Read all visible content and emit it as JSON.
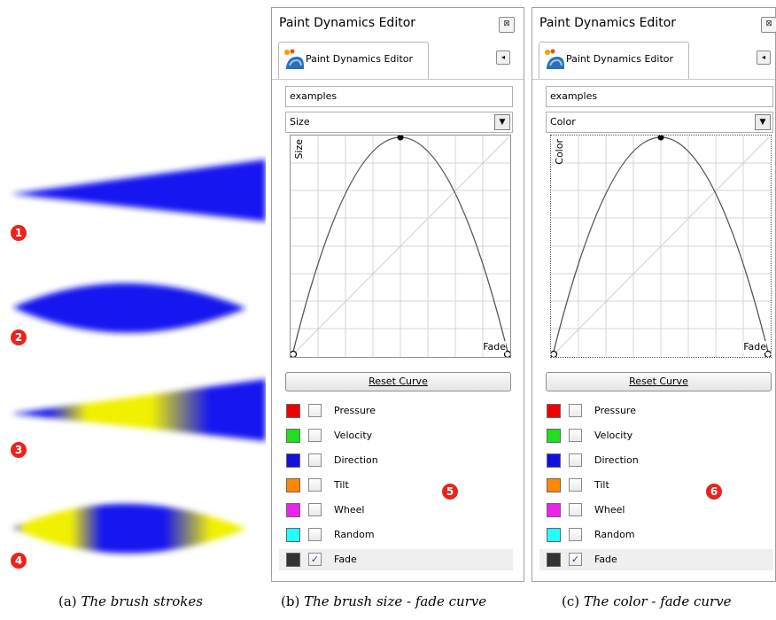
{
  "strokes": {
    "badges": [
      "1",
      "2",
      "3",
      "4"
    ],
    "colors": {
      "blue": "#1414f0",
      "yellow": "#f0f000",
      "badge": "#e8241c"
    }
  },
  "panels": [
    {
      "title": "Paint Dynamics Editor",
      "tab_label": "Paint Dynamics Editor",
      "close_glyph": "⊠",
      "tab_menu_glyph": "◂",
      "name_value": "examples",
      "output_value": "Size",
      "curve_y_label": "Size",
      "curve_x_label": "Fade",
      "reset_label": "Reset Curve",
      "badge": "5",
      "caption": "(b)",
      "caption_text": "The brush size - fade curve"
    },
    {
      "title": "Paint Dynamics Editor",
      "tab_label": "Paint Dynamics Editor",
      "close_glyph": "⊠",
      "tab_menu_glyph": "◂",
      "name_value": "examples",
      "output_value": "Color",
      "curve_y_label": "Color",
      "curve_x_label": "Fade",
      "reset_label": "Reset Curve",
      "badge": "6",
      "caption": "(c)",
      "caption_text": "The color - fade curve"
    }
  ],
  "dynamics": [
    {
      "label": "Pressure",
      "color": "#ee0000",
      "checked": false
    },
    {
      "label": "Velocity",
      "color": "#22dd22",
      "checked": false
    },
    {
      "label": "Direction",
      "color": "#1111dd",
      "checked": false
    },
    {
      "label": "Tilt",
      "color": "#ff8800",
      "checked": false
    },
    {
      "label": "Wheel",
      "color": "#ee22ee",
      "checked": false
    },
    {
      "label": "Random",
      "color": "#22ffff",
      "checked": false
    },
    {
      "label": "Fade",
      "color": "#333333",
      "checked": true
    }
  ],
  "caption_a": {
    "prefix": "(a)",
    "text": "The brush strokes"
  },
  "select_arrow_glyph": "▼",
  "check_glyph": "✓"
}
